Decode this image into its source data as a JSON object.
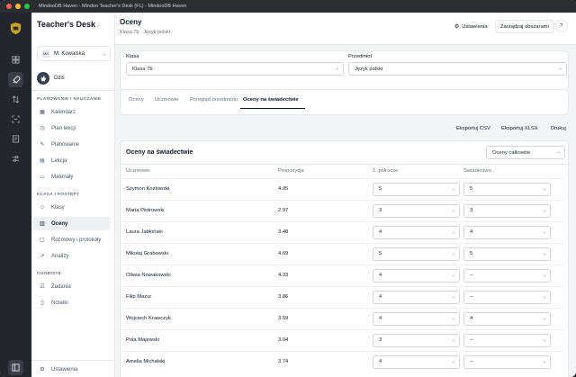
{
  "window": {
    "title": "MindooDB Haven - Mindoo Teacher's Desk (FL) - MindooDB Haven",
    "traffic": [
      "#ff5f57",
      "#febc2e",
      "#28c840"
    ]
  },
  "sidebar": {
    "brand": "Teacher's Desk",
    "user": {
      "initials": "MK",
      "name": "M. Kowalska"
    },
    "today": "Dziś",
    "sections": [
      {
        "label": "PLANOWANIE I NAUCZANIE",
        "items": [
          "Kalendarz",
          "Plan lekcji",
          "Planowanie",
          "Lekcja",
          "Materiały"
        ]
      },
      {
        "label": "KLASA I POSTĘPY",
        "items": [
          "Klasy",
          "Oceny",
          "Rozmowy i protokoły",
          "Analizy"
        ]
      },
      {
        "label": "OSOBISTE",
        "items": [
          "Zadania",
          "Notatki"
        ]
      }
    ],
    "settings": "Ustawienia",
    "icons": [
      "calendar-icon",
      "clock-icon",
      "pencil-icon",
      "book-icon",
      "folder-icon",
      "users-icon",
      "chart-icon",
      "chat-icon",
      "analytics-icon",
      "check-icon",
      "note-icon",
      "gear-icon"
    ]
  },
  "header": {
    "title": "Oceny",
    "breadcrumb": "Klasa 7b · Język polski",
    "settings_btn": "Ustawienia",
    "manage_btn": "Zarządzaj obszarami",
    "help": "?"
  },
  "filters": {
    "class_label": "Klasa",
    "class_value": "Klasa 7b",
    "subject_label": "Przedmiot",
    "subject_value": "Język polski"
  },
  "tabs": [
    "Oceny",
    "Uczniowie",
    "Przegląd przedmiotu",
    "Oceny na świadectwie"
  ],
  "export": {
    "csv": "Eksportuj CSV",
    "xlsx": "Eksportuj XLSX",
    "print": "Drukuj"
  },
  "table": {
    "title": "Oceny na świadectwie",
    "view_select": "Oceny całkowite",
    "columns": [
      "Uczniowie",
      "Propozycja",
      "1. półrocze",
      "Świadectwo"
    ],
    "rows": [
      {
        "name": "Szymon Kozłowski",
        "proposal": "4.95",
        "half": "5",
        "cert": "5"
      },
      {
        "name": "Maria Piotrowski",
        "proposal": "2.97",
        "half": "3",
        "cert": "3"
      },
      {
        "name": "Laura Jabłoński",
        "proposal": "3.48",
        "half": "4",
        "cert": "4"
      },
      {
        "name": "Mikołaj Grabowski",
        "proposal": "4.69",
        "half": "5",
        "cert": "5"
      },
      {
        "name": "Oliwia Nowakowski",
        "proposal": "4.33",
        "half": "4",
        "cert": "–"
      },
      {
        "name": "Filip Mazur",
        "proposal": "3.86",
        "half": "4",
        "cert": "–"
      },
      {
        "name": "Wojciech Krawczyk",
        "proposal": "3.59",
        "half": "4",
        "cert": "4"
      },
      {
        "name": "Pola Majewski",
        "proposal": "3.04",
        "half": "3",
        "cert": "–"
      },
      {
        "name": "Amelia Michalski",
        "proposal": "3.74",
        "half": "4",
        "cert": "–"
      }
    ]
  },
  "colors": {
    "rail": "#23262b",
    "accent": "#111827"
  }
}
